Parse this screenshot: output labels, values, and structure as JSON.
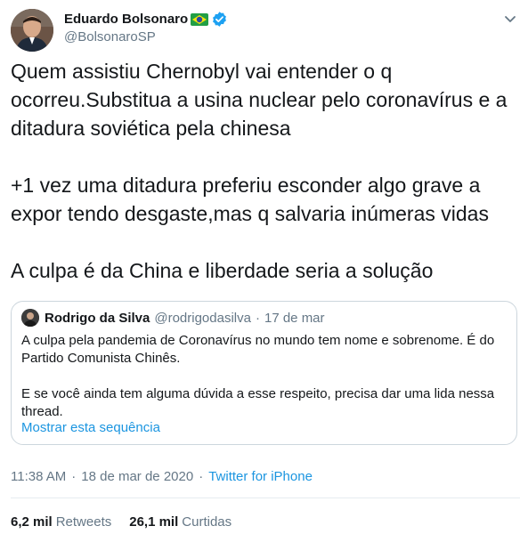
{
  "author": {
    "name": "Eduardo Bolsonaro",
    "handle": "@BolsonaroSP"
  },
  "tweet_paragraphs": [
    "Quem assistiu Chernobyl vai entender o q\nocorreu.Substitua a usina nuclear pelo coronavírus e a\nditadura soviética pela chinesa",
    "+1 vez uma ditadura preferiu esconder algo grave a\nexpor tendo desgaste,mas q salvaria inúmeras vidas",
    "A culpa é da China e liberdade seria a solução"
  ],
  "quoted": {
    "name": "Rodrigo da Silva",
    "handle": "@rodrigodasilva",
    "separator": "·",
    "date": "17 de mar",
    "paragraphs": [
      "A culpa pela pandemia de Coronavírus no mundo tem nome e sobrenome. É do Partido Comunista Chinês.",
      "E se você ainda tem alguma dúvida a esse respeito, precisa dar uma lida nessa thread."
    ],
    "show_thread": "Mostrar esta sequência"
  },
  "meta": {
    "time": "11:38 AM",
    "separator": "·",
    "date": "18 de mar de 2020",
    "source": "Twitter for iPhone"
  },
  "stats": {
    "retweets_count": "6,2 mil",
    "retweets_label": "Retweets",
    "likes_count": "26,1 mil",
    "likes_label": "Curtidas"
  },
  "colors": {
    "link": "#1b95e0",
    "muted": "#657786",
    "border": "#ccd6dd",
    "verified": "#1da1f2"
  }
}
